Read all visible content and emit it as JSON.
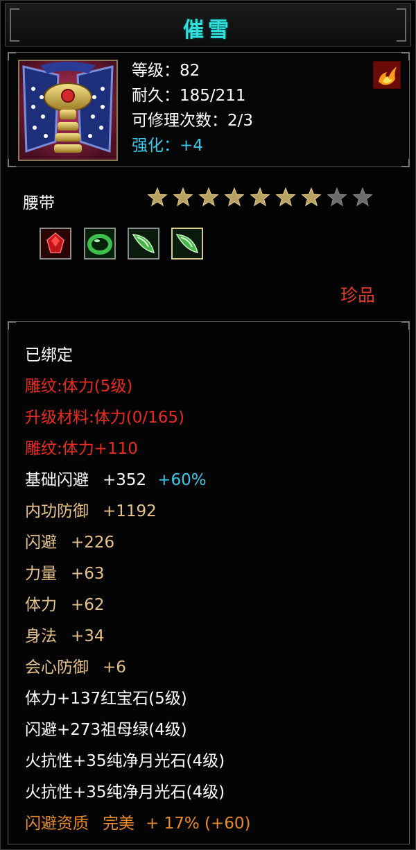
{
  "item": {
    "name": "催雪",
    "type": "腰带",
    "quality": "珍品",
    "level_label": "等级：82",
    "durability_label": "耐久：185/211",
    "repair_label": "可修理次数：2/3",
    "enhance_label": "强化：",
    "enhance_value": "+4",
    "star_rating": {
      "filled": 7,
      "total": 9
    },
    "icons": {
      "portrait": "belt-portrait-icon",
      "special": "flame-icon"
    },
    "gem_slots": [
      {
        "icon": "red-gem-icon",
        "color": "#c2171a"
      },
      {
        "icon": "green-ring-icon",
        "color": "#2f9b3a"
      },
      {
        "icon": "green-moonstone-icon",
        "color": "#46b54a"
      },
      {
        "icon": "green-moonstone-icon",
        "color": "#46b54a"
      }
    ]
  },
  "attributes": [
    {
      "name": "已绑定",
      "value": "",
      "extra": "",
      "color": "#ffffff"
    },
    {
      "name": "雕纹:体力(5级)",
      "value": "",
      "extra": "",
      "color": "#ec2a1f"
    },
    {
      "name": "升级材料:体力(0/165)",
      "value": "",
      "extra": "",
      "color": "#ec2a1f"
    },
    {
      "name": "雕纹:体力+110",
      "value": "",
      "extra": "",
      "color": "#ec2a1f"
    },
    {
      "name": "基础闪避",
      "value": "+352",
      "extra": "+60%",
      "color": "#ffffff"
    },
    {
      "name": "内功防御",
      "value": "+1192",
      "extra": "",
      "color": "#e6c28a"
    },
    {
      "name": "闪避",
      "value": "+226",
      "extra": "",
      "color": "#e6c28a"
    },
    {
      "name": "力量",
      "value": "+63",
      "extra": "",
      "color": "#e6c28a"
    },
    {
      "name": "体力",
      "value": "+62",
      "extra": "",
      "color": "#e6c28a"
    },
    {
      "name": "身法",
      "value": "+34",
      "extra": "",
      "color": "#e6c28a"
    },
    {
      "name": "会心防御",
      "value": "+6",
      "extra": "",
      "color": "#e6c28a"
    },
    {
      "name": "体力+137红宝石(5级)",
      "value": "",
      "extra": "",
      "color": "#ffffff"
    },
    {
      "name": "闪避+273祖母绿(4级)",
      "value": "",
      "extra": "",
      "color": "#ffffff"
    },
    {
      "name": "火抗性+35纯净月光石(4级)",
      "value": "",
      "extra": "",
      "color": "#ffffff"
    },
    {
      "name": "火抗性+35纯净月光石(4级)",
      "value": "",
      "extra": "",
      "color": "#ffffff"
    },
    {
      "name": "闪避资质",
      "value": "完美",
      "extra": "+ 17% (+60)",
      "color": "#e98a27"
    }
  ]
}
